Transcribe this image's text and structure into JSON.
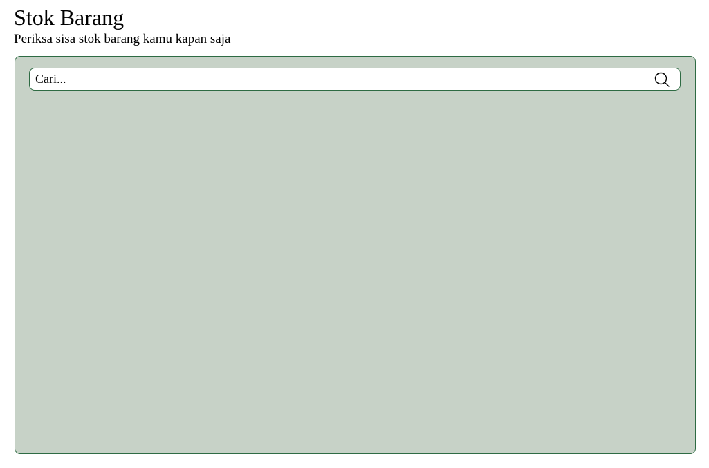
{
  "header": {
    "title": "Stok Barang",
    "subtitle": "Periksa sisa stok barang kamu kapan saja"
  },
  "search": {
    "placeholder": "Cari...",
    "value": "",
    "button_icon": "search-icon"
  },
  "colors": {
    "panel_background": "#c7d2c7",
    "border": "#2e6b43"
  }
}
